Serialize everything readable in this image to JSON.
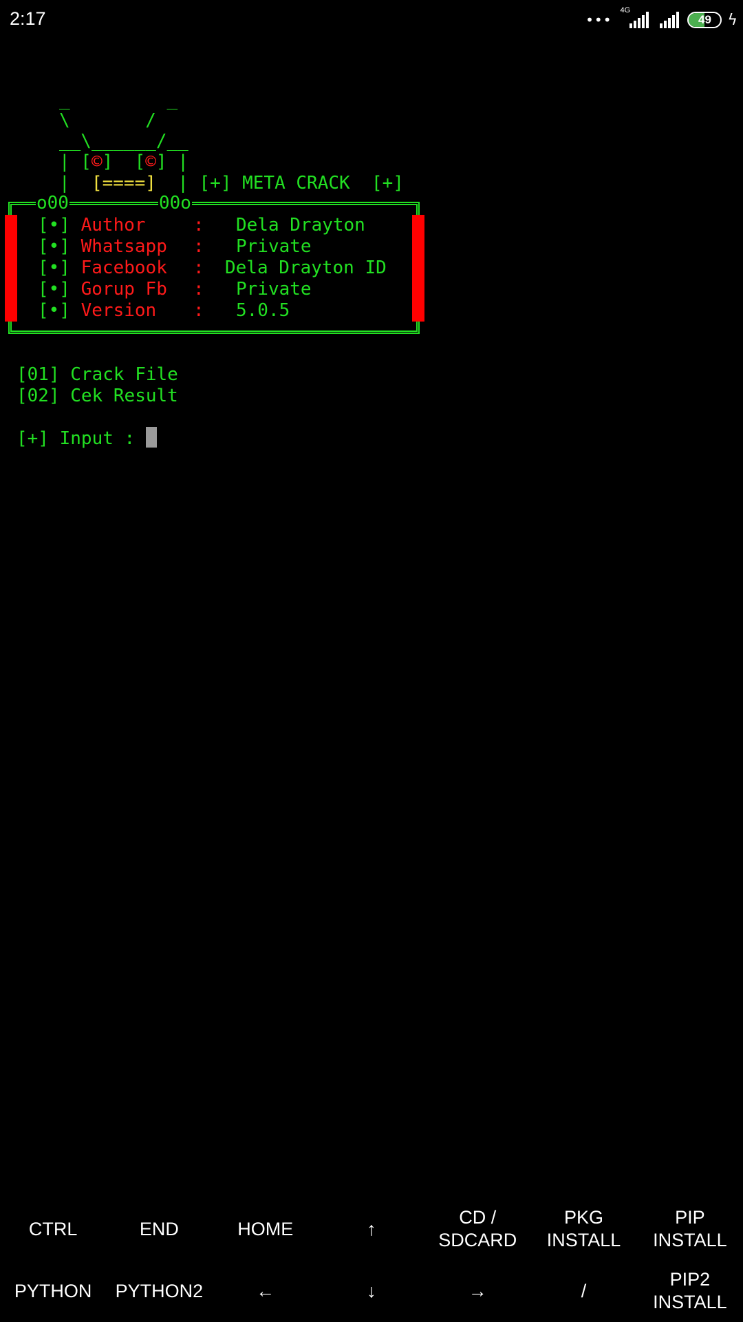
{
  "status_bar": {
    "time": "2:17",
    "dots": "•••",
    "network_label": "4G",
    "battery": "49",
    "battery_level": 0.49,
    "accent_color": "#4caf50"
  },
  "terminal": {
    "colors": {
      "green": "#22e022",
      "red": "#ff1a1a",
      "yellow": "#f0e040"
    },
    "banner": {
      "ears_line": "_         _",
      "slash_line": "\\       /",
      "head_line": "__\\______/__",
      "eye_left_open": "| [",
      "eye_glyph": "©",
      "eye_mid": "]  [",
      "eye_right_close": "] |",
      "mouth_pre": "|  ",
      "mouth": "[====]",
      "mouth_post": "  |",
      "title": " [+] META CRACK  [+]",
      "frame_top_left": "o00",
      "frame_top_right": "00o"
    },
    "info_rows": [
      {
        "bullet": "[•]",
        "label": "Author",
        "sep": ":",
        "value": "Dela Drayton"
      },
      {
        "bullet": "[•]",
        "label": "Whatsapp",
        "sep": ":",
        "value": "Private"
      },
      {
        "bullet": "[•]",
        "label": "Facebook",
        "sep": ":",
        "value": "Dela Drayton ID"
      },
      {
        "bullet": "[•]",
        "label": "Gorup Fb",
        "sep": ":",
        "value": "Private"
      },
      {
        "bullet": "[•]",
        "label": "Version",
        "sep": ":",
        "value": "5.0.5"
      }
    ],
    "menu": [
      {
        "num": "[01]",
        "label": "Crack File"
      },
      {
        "num": "[02]",
        "label": "Cek Result"
      }
    ],
    "prompt": "[+] Input : "
  },
  "extra_keys": {
    "row1": [
      "CTRL",
      "END",
      "HOME",
      "↑",
      "CD /\nSDCARD",
      "PKG\nINSTALL",
      "PIP\nINSTALL"
    ],
    "row2": [
      "PYTHON",
      "PYTHON2",
      "←",
      "↓",
      "→",
      "/",
      "PIP2\nINSTALL"
    ]
  }
}
